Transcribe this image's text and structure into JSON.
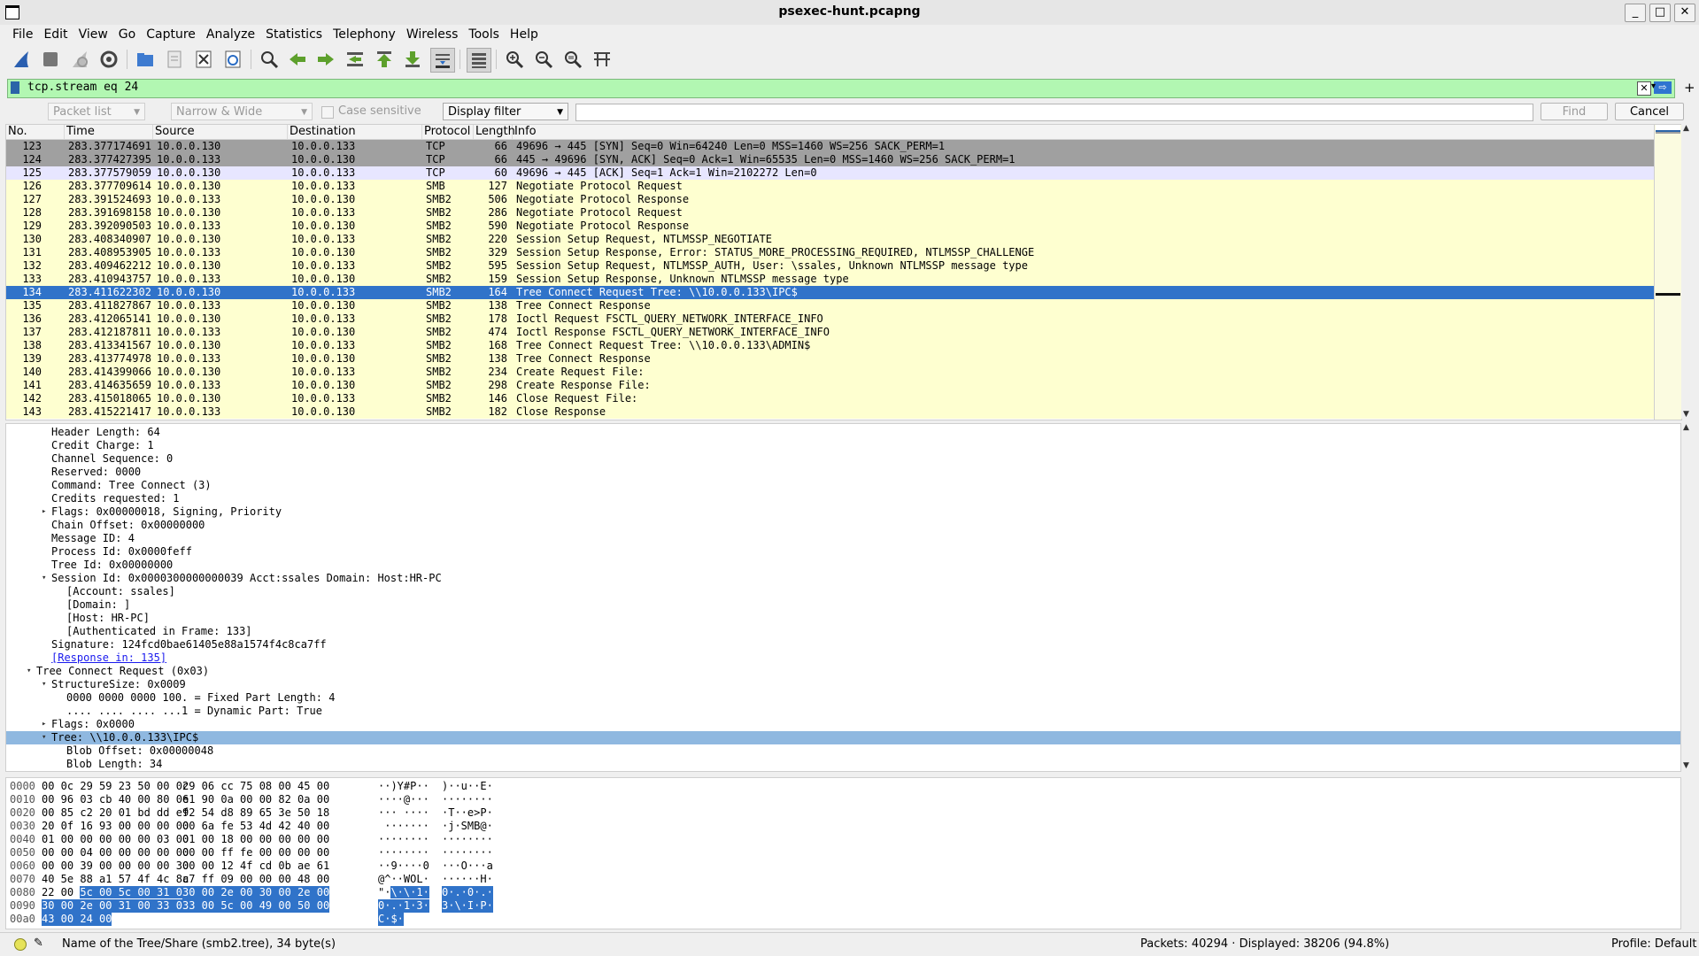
{
  "window": {
    "title": "psexec-hunt.pcapng",
    "controls": {
      "minimize": "_",
      "maximize": "□",
      "close": "✕"
    }
  },
  "menu": [
    "File",
    "Edit",
    "View",
    "Go",
    "Capture",
    "Analyze",
    "Statistics",
    "Telephony",
    "Wireless",
    "Tools",
    "Help"
  ],
  "toolbar_icons": [
    "shark-fin-start-icon",
    "stop-capture-icon",
    "restart-capture-icon",
    "capture-options-icon",
    "open-file-icon",
    "save-file-icon",
    "close-file-icon",
    "reload-file-icon",
    "find-packet-icon",
    "go-back-icon",
    "go-forward-icon",
    "go-to-packet-icon",
    "go-first-icon",
    "go-last-icon",
    "autoscroll-icon",
    "colorize-icon",
    "zoom-in-icon",
    "zoom-out-icon",
    "zoom-normal-icon",
    "resize-columns-icon"
  ],
  "filter": {
    "value": "tcp.stream eq 24",
    "plus": "+"
  },
  "find": {
    "scope": "Packet list",
    "width": "Narrow & Wide",
    "case_sensitive": "Case sensitive",
    "type": "Display filter",
    "find_button": "Find",
    "cancel_button": "Cancel"
  },
  "packet_list": {
    "columns": [
      "No.",
      "Time",
      "Source",
      "Destination",
      "Protocol",
      "Length",
      "Info"
    ],
    "rows": [
      {
        "no": "123",
        "time": "283.377174691",
        "src": "10.0.0.130",
        "dst": "10.0.0.133",
        "proto": "TCP",
        "len": "66",
        "info": "49696 → 445 [SYN] Seq=0 Win=64240 Len=0 MSS=1460 WS=256 SACK_PERM=1",
        "style": "tcp"
      },
      {
        "no": "124",
        "time": "283.377427395",
        "src": "10.0.0.133",
        "dst": "10.0.0.130",
        "proto": "TCP",
        "len": "66",
        "info": "445 → 49696 [SYN, ACK] Seq=0 Ack=1 Win=65535 Len=0 MSS=1460 WS=256 SACK_PERM=1",
        "style": "tcp"
      },
      {
        "no": "125",
        "time": "283.377579059",
        "src": "10.0.0.130",
        "dst": "10.0.0.133",
        "proto": "TCP",
        "len": "60",
        "info": "49696 → 445 [ACK] Seq=1 Ack=1 Win=2102272 Len=0",
        "style": "ack"
      },
      {
        "no": "126",
        "time": "283.377709614",
        "src": "10.0.0.130",
        "dst": "10.0.0.133",
        "proto": "SMB",
        "len": "127",
        "info": "Negotiate Protocol Request",
        "style": "smb"
      },
      {
        "no": "127",
        "time": "283.391524693",
        "src": "10.0.0.133",
        "dst": "10.0.0.130",
        "proto": "SMB2",
        "len": "506",
        "info": "Negotiate Protocol Response",
        "style": "smb"
      },
      {
        "no": "128",
        "time": "283.391698158",
        "src": "10.0.0.130",
        "dst": "10.0.0.133",
        "proto": "SMB2",
        "len": "286",
        "info": "Negotiate Protocol Request",
        "style": "smb"
      },
      {
        "no": "129",
        "time": "283.392090503",
        "src": "10.0.0.133",
        "dst": "10.0.0.130",
        "proto": "SMB2",
        "len": "590",
        "info": "Negotiate Protocol Response",
        "style": "smb"
      },
      {
        "no": "130",
        "time": "283.408340907",
        "src": "10.0.0.130",
        "dst": "10.0.0.133",
        "proto": "SMB2",
        "len": "220",
        "info": "Session Setup Request, NTLMSSP_NEGOTIATE",
        "style": "smb"
      },
      {
        "no": "131",
        "time": "283.408953905",
        "src": "10.0.0.133",
        "dst": "10.0.0.130",
        "proto": "SMB2",
        "len": "329",
        "info": "Session Setup Response, Error: STATUS_MORE_PROCESSING_REQUIRED, NTLMSSP_CHALLENGE",
        "style": "smb"
      },
      {
        "no": "132",
        "time": "283.409462212",
        "src": "10.0.0.130",
        "dst": "10.0.0.133",
        "proto": "SMB2",
        "len": "595",
        "info": "Session Setup Request, NTLMSSP_AUTH, User: \\ssales, Unknown NTLMSSP message type",
        "style": "smb"
      },
      {
        "no": "133",
        "time": "283.410943757",
        "src": "10.0.0.133",
        "dst": "10.0.0.130",
        "proto": "SMB2",
        "len": "159",
        "info": "Session Setup Response, Unknown NTLMSSP message type",
        "style": "smb"
      },
      {
        "no": "134",
        "time": "283.411622302",
        "src": "10.0.0.130",
        "dst": "10.0.0.133",
        "proto": "SMB2",
        "len": "164",
        "info": "Tree Connect Request Tree: \\\\10.0.0.133\\IPC$",
        "style": "sel"
      },
      {
        "no": "135",
        "time": "283.411827867",
        "src": "10.0.0.133",
        "dst": "10.0.0.130",
        "proto": "SMB2",
        "len": "138",
        "info": "Tree Connect Response",
        "style": "smb"
      },
      {
        "no": "136",
        "time": "283.412065141",
        "src": "10.0.0.130",
        "dst": "10.0.0.133",
        "proto": "SMB2",
        "len": "178",
        "info": "Ioctl Request FSCTL_QUERY_NETWORK_INTERFACE_INFO",
        "style": "smb"
      },
      {
        "no": "137",
        "time": "283.412187811",
        "src": "10.0.0.133",
        "dst": "10.0.0.130",
        "proto": "SMB2",
        "len": "474",
        "info": "Ioctl Response FSCTL_QUERY_NETWORK_INTERFACE_INFO",
        "style": "smb"
      },
      {
        "no": "138",
        "time": "283.413341567",
        "src": "10.0.0.130",
        "dst": "10.0.0.133",
        "proto": "SMB2",
        "len": "168",
        "info": "Tree Connect Request Tree: \\\\10.0.0.133\\ADMIN$",
        "style": "smb"
      },
      {
        "no": "139",
        "time": "283.413774978",
        "src": "10.0.0.133",
        "dst": "10.0.0.130",
        "proto": "SMB2",
        "len": "138",
        "info": "Tree Connect Response",
        "style": "smb"
      },
      {
        "no": "140",
        "time": "283.414399066",
        "src": "10.0.0.130",
        "dst": "10.0.0.133",
        "proto": "SMB2",
        "len": "234",
        "info": "Create Request File:",
        "style": "smb"
      },
      {
        "no": "141",
        "time": "283.414635659",
        "src": "10.0.0.133",
        "dst": "10.0.0.130",
        "proto": "SMB2",
        "len": "298",
        "info": "Create Response File:",
        "style": "smb"
      },
      {
        "no": "142",
        "time": "283.415018065",
        "src": "10.0.0.130",
        "dst": "10.0.0.133",
        "proto": "SMB2",
        "len": "146",
        "info": "Close Request File:",
        "style": "smb"
      },
      {
        "no": "143",
        "time": "283.415221417",
        "src": "10.0.0.133",
        "dst": "10.0.0.130",
        "proto": "SMB2",
        "len": "182",
        "info": "Close Response",
        "style": "smb"
      }
    ]
  },
  "details": [
    {
      "indent": 3,
      "text": "Header Length: 64",
      "tw": ""
    },
    {
      "indent": 3,
      "text": "Credit Charge: 1",
      "tw": ""
    },
    {
      "indent": 3,
      "text": "Channel Sequence: 0",
      "tw": ""
    },
    {
      "indent": 3,
      "text": "Reserved: 0000",
      "tw": ""
    },
    {
      "indent": 3,
      "text": "Command: Tree Connect (3)",
      "tw": ""
    },
    {
      "indent": 3,
      "text": "Credits requested: 1",
      "tw": ""
    },
    {
      "indent": 3,
      "text": "Flags: 0x00000018, Signing, Priority",
      "tw": "▸"
    },
    {
      "indent": 3,
      "text": "Chain Offset: 0x00000000",
      "tw": ""
    },
    {
      "indent": 3,
      "text": "Message ID: 4",
      "tw": ""
    },
    {
      "indent": 3,
      "text": "Process Id: 0x0000feff",
      "tw": ""
    },
    {
      "indent": 3,
      "text": "Tree Id: 0x00000000",
      "tw": ""
    },
    {
      "indent": 3,
      "text": "Session Id: 0x0000300000000039 Acct:ssales Domain: Host:HR-PC",
      "tw": "▾"
    },
    {
      "indent": 4,
      "text": "[Account: ssales]",
      "tw": ""
    },
    {
      "indent": 4,
      "text": "[Domain: ]",
      "tw": ""
    },
    {
      "indent": 4,
      "text": "[Host: HR-PC]",
      "tw": ""
    },
    {
      "indent": 4,
      "text": "[Authenticated in Frame: 133]",
      "tw": ""
    },
    {
      "indent": 3,
      "text": "Signature: 124fcd0bae61405e88a1574f4c8ca7ff",
      "tw": ""
    },
    {
      "indent": 3,
      "text": "[Response in: 135]",
      "tw": "",
      "link": true
    },
    {
      "indent": 2,
      "text": "Tree Connect Request (0x03)",
      "tw": "▾"
    },
    {
      "indent": 3,
      "text": "StructureSize: 0x0009",
      "tw": "▾"
    },
    {
      "indent": 4,
      "text": "0000 0000 0000 100. = Fixed Part Length: 4",
      "tw": ""
    },
    {
      "indent": 4,
      "text": ".... .... .... ...1 = Dynamic Part: True",
      "tw": ""
    },
    {
      "indent": 3,
      "text": "Flags: 0x0000",
      "tw": "▸"
    },
    {
      "indent": 3,
      "text": "Tree: \\\\10.0.0.133\\IPC$",
      "tw": "▾",
      "sel": true
    },
    {
      "indent": 4,
      "text": "Blob Offset: 0x00000048",
      "tw": ""
    },
    {
      "indent": 4,
      "text": "Blob Length: 34",
      "tw": ""
    }
  ],
  "hex": [
    {
      "off": "0000",
      "b1": "00 0c 29 59 23 50 00 0c",
      "b2": "29 06 cc 75 08 00 45 00",
      "a1": "··)Y#P··",
      "a2": ")··u··E·",
      "h1": 0,
      "h2": 0
    },
    {
      "off": "0010",
      "b1": "00 96 03 cb 40 00 80 06",
      "b2": "e1 90 0a 00 00 82 0a 00",
      "a1": "····@···",
      "a2": "········",
      "h1": 0,
      "h2": 0
    },
    {
      "off": "0020",
      "b1": "00 85 c2 20 01 bd dd ef",
      "b2": "92 54 d8 89 65 3e 50 18",
      "a1": "··· ····",
      "a2": "·T··e>P·",
      "h1": 0,
      "h2": 0
    },
    {
      "off": "0030",
      "b1": "20 0f 16 93 00 00 00 00",
      "b2": "00 6a fe 53 4d 42 40 00",
      "a1": " ·······",
      "a2": "·j·SMB@·",
      "h1": 0,
      "h2": 0
    },
    {
      "off": "0040",
      "b1": "01 00 00 00 00 00 03 00",
      "b2": "01 00 18 00 00 00 00 00",
      "a1": "········",
      "a2": "········",
      "h1": 0,
      "h2": 0
    },
    {
      "off": "0050",
      "b1": "00 00 04 00 00 00 00 00",
      "b2": "00 00 ff fe 00 00 00 00",
      "a1": "········",
      "a2": "········",
      "h1": 0,
      "h2": 0
    },
    {
      "off": "0060",
      "b1": "00 00 39 00 00 00 00 30",
      "b2": "00 00 12 4f cd 0b ae 61",
      "a1": "··9····0",
      "a2": "···O···a",
      "h1": 0,
      "h2": 0
    },
    {
      "off": "0070",
      "b1": "40 5e 88 a1 57 4f 4c 8c",
      "b2": "a7 ff 09 00 00 00 48 00",
      "a1": "@^··WOL·",
      "a2": "······H·",
      "h1": 0,
      "h2": 0
    },
    {
      "off": "0080",
      "b1": "22 00 5c 00 5c 00 31 00",
      "b2": "30 00 2e 00 30 00 2e 00",
      "a1": "\"·\\·\\·1·",
      "a2": "0·.·0·.·",
      "h1": 1,
      "h2": 1
    },
    {
      "off": "0090",
      "b1": "30 00 2e 00 31 00 33 00",
      "b2": "33 00 5c 00 49 00 50 00",
      "a1": "0·.·1·3·",
      "a2": "3·\\·I·P·",
      "h1": 2,
      "h2": 2
    },
    {
      "off": "00a0",
      "b1": "43 00 24 00",
      "b2": "",
      "a1": "C·$·",
      "a2": "",
      "h1": 2,
      "h2": 0
    }
  ],
  "status": {
    "field_info": "Name of the Tree/Share (smb2.tree), 34 byte(s)",
    "packets": "Packets: 40294 · Displayed: 38206 (94.8%)",
    "profile": "Profile: Default"
  },
  "colors": {
    "tcp": "#a0a0a0",
    "ack": "#e7e6ff",
    "smb": "#feffd0",
    "sel": "#3073c9",
    "filter_ok": "#b2f7b2"
  }
}
